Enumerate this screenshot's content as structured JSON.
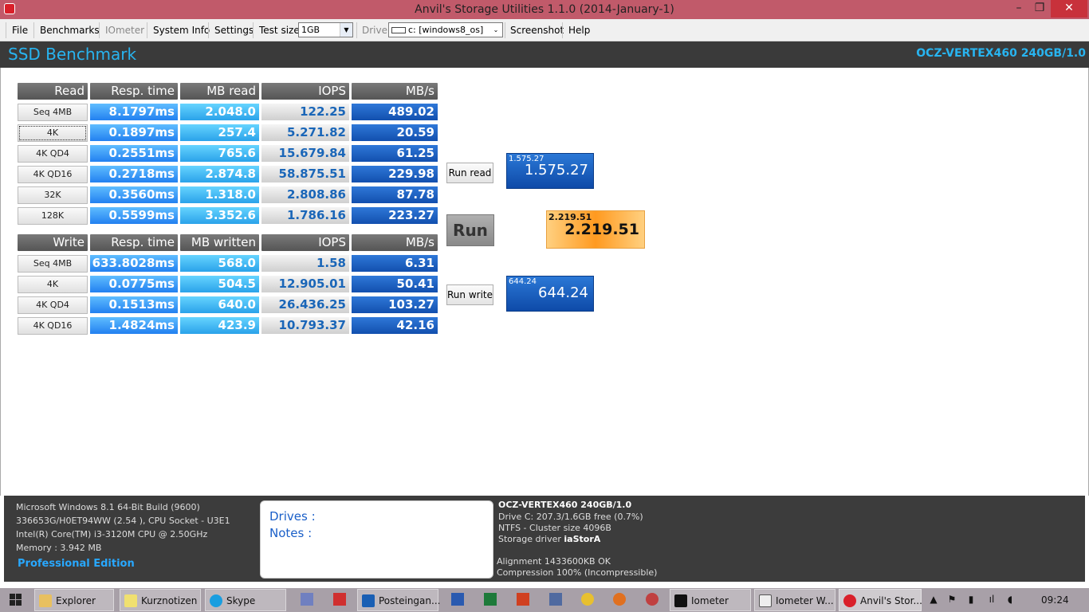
{
  "window": {
    "title": "Anvil's Storage Utilities 1.1.0 (2014-January-1)",
    "minimize": "–",
    "restore": "❐",
    "close": "✕"
  },
  "menu": {
    "file": "File",
    "benchmarks": "Benchmarks",
    "iometer": "IOmeter",
    "system_info": "System Info",
    "settings": "Settings",
    "test_size_label": "Test size",
    "test_size_value": "1GB",
    "drive_label": "Drive",
    "drive_value": "c: [windows8_os]",
    "screenshot": "Screenshot",
    "help": "Help"
  },
  "header": {
    "title": "SSD Benchmark",
    "model": "OCZ-VERTEX460 240GB/1.0"
  },
  "read_table": {
    "headers": [
      "Read",
      "Resp. time",
      "MB read",
      "IOPS",
      "MB/s"
    ],
    "rows": [
      {
        "label": "Seq 4MB",
        "resp": "8.1797ms",
        "mb": "2.048.0",
        "iops": "122.25",
        "mbs": "489.02"
      },
      {
        "label": "4K",
        "resp": "0.1897ms",
        "mb": "257.4",
        "iops": "5.271.82",
        "mbs": "20.59"
      },
      {
        "label": "4K QD4",
        "resp": "0.2551ms",
        "mb": "765.6",
        "iops": "15.679.84",
        "mbs": "61.25"
      },
      {
        "label": "4K QD16",
        "resp": "0.2718ms",
        "mb": "2.874.8",
        "iops": "58.875.51",
        "mbs": "229.98"
      },
      {
        "label": "32K",
        "resp": "0.3560ms",
        "mb": "1.318.0",
        "iops": "2.808.86",
        "mbs": "87.78"
      },
      {
        "label": "128K",
        "resp": "0.5599ms",
        "mb": "3.352.6",
        "iops": "1.786.16",
        "mbs": "223.27"
      }
    ]
  },
  "write_table": {
    "headers": [
      "Write",
      "Resp. time",
      "MB written",
      "IOPS",
      "MB/s"
    ],
    "rows": [
      {
        "label": "Seq 4MB",
        "resp": "633.8028ms",
        "mb": "568.0",
        "iops": "1.58",
        "mbs": "6.31"
      },
      {
        "label": "4K",
        "resp": "0.0775ms",
        "mb": "504.5",
        "iops": "12.905.01",
        "mbs": "50.41"
      },
      {
        "label": "4K QD4",
        "resp": "0.1513ms",
        "mb": "640.0",
        "iops": "26.436.25",
        "mbs": "103.27"
      },
      {
        "label": "4K QD16",
        "resp": "1.4824ms",
        "mb": "423.9",
        "iops": "10.793.37",
        "mbs": "42.16"
      }
    ]
  },
  "controls": {
    "run_read": "Run read",
    "run": "Run",
    "run_write": "Run write"
  },
  "scores": {
    "read": {
      "small": "1.575.27",
      "big": "1.575.27"
    },
    "total": {
      "small": "2.219.51",
      "big": "2.219.51"
    },
    "write": {
      "small": "644.24",
      "big": "644.24"
    }
  },
  "system": {
    "os": "Microsoft Windows 8.1 64-Bit Build (9600)",
    "board": "336653G/H0ET94WW (2.54 ), CPU Socket - U3E1",
    "cpu": "Intel(R) Core(TM) i3-3120M CPU @ 2.50GHz",
    "memory": "Memory : 3.942 MB",
    "edition": "Professional Edition"
  },
  "notes": {
    "drives": "Drives :",
    "notes": "Notes :"
  },
  "drive_info": {
    "model": "OCZ-VERTEX460 240GB/1.0",
    "free": "Drive C: 207.3/1.6GB free (0.7%)",
    "fs": "NTFS - Cluster size 4096B",
    "driver_label": "Storage driver",
    "driver": "iaStorA",
    "alignment": "Alignment 1433600KB OK",
    "compression": "Compression 100% (Incompressible)"
  },
  "taskbar": {
    "items": [
      "Explorer",
      "Kurznotizen",
      "Skype",
      "Posteingan...",
      "Iometer",
      "Iometer W...",
      "Anvil's Stor..."
    ],
    "clock": "09:24"
  },
  "colors": {
    "accent": "#28b4f0",
    "titlebar": "#c15a6a",
    "header_bg": "#3a3a3a",
    "total_orange": "#ff9a20",
    "score_blue": "#1560c0"
  }
}
